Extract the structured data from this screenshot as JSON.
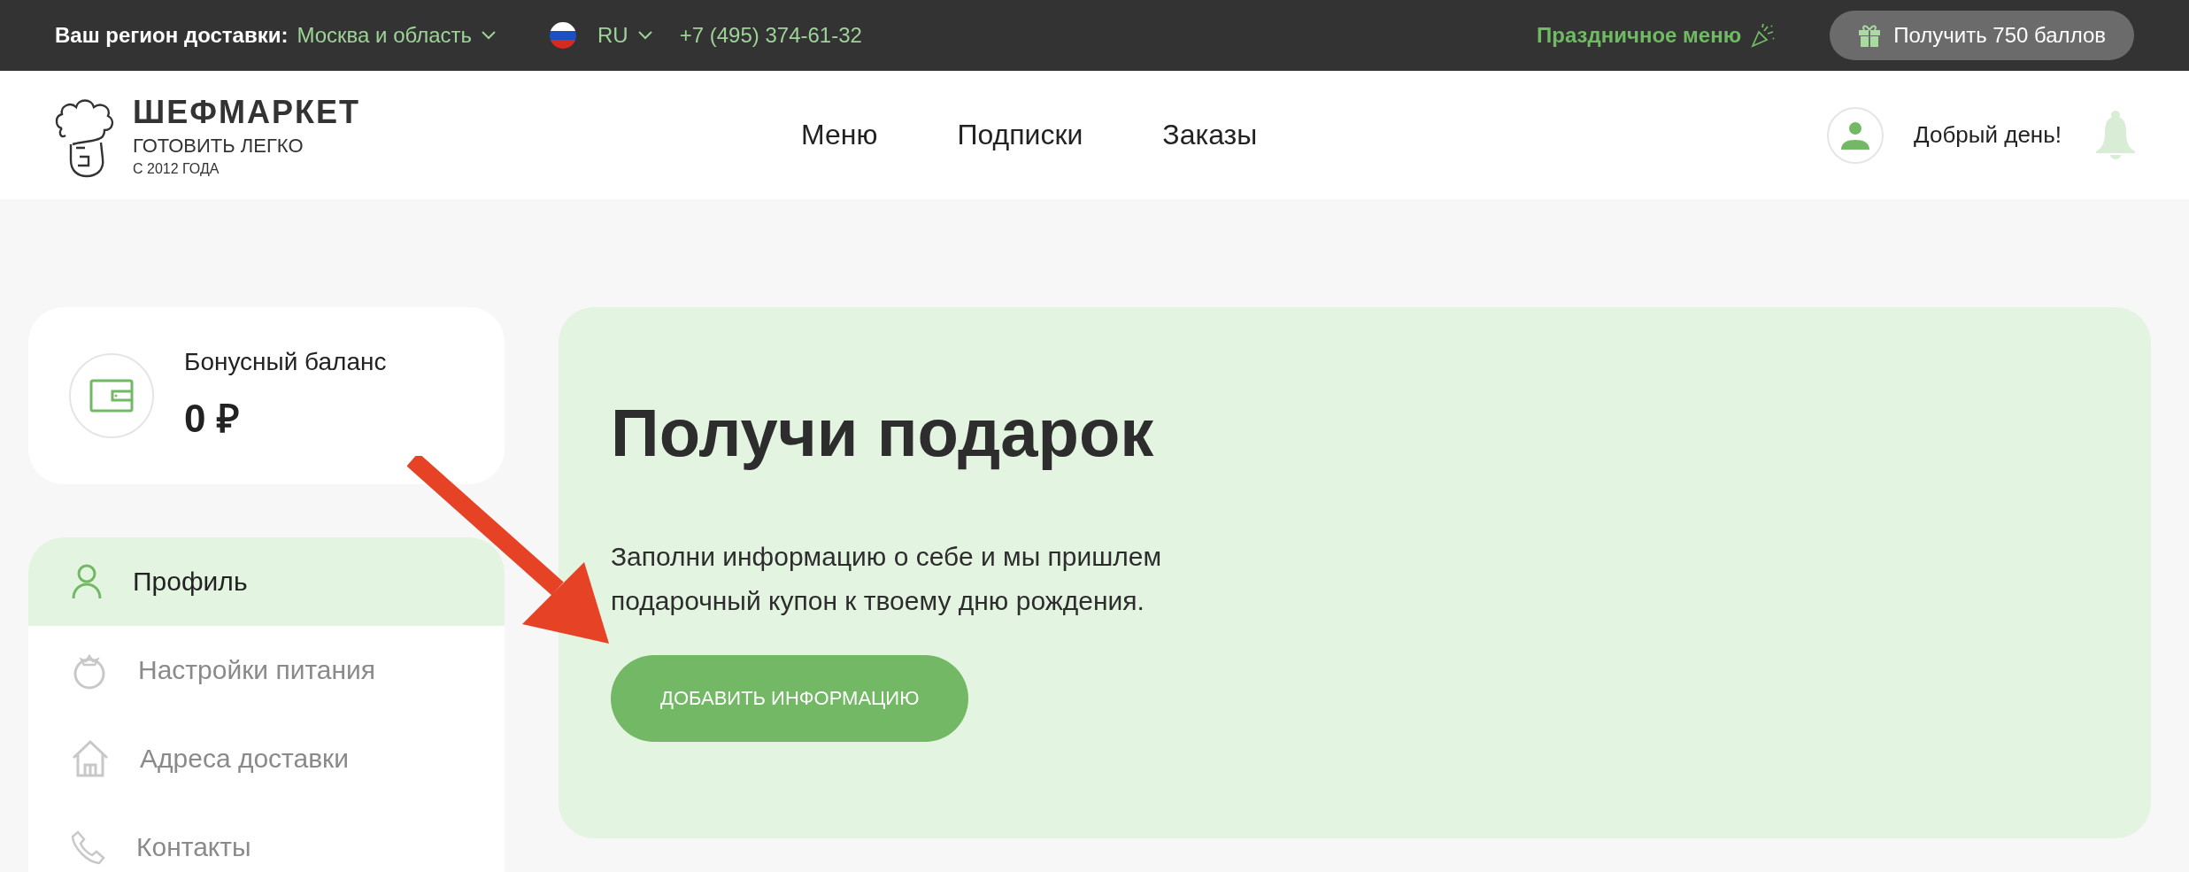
{
  "top_bar": {
    "region_label": "Ваш регион доставки:",
    "region_value": "Москва и область",
    "language": "RU",
    "phone": "+7 (495) 374-61-32",
    "holiday_menu": "Праздничное меню",
    "bonus_button": "Получить 750 баллов"
  },
  "header": {
    "logo": {
      "name": "ШЕФМАРКЕТ",
      "tagline": "ГОТОВИТЬ ЛЕГКО",
      "since": "С 2012 ГОДА"
    },
    "nav": [
      {
        "label": "Меню"
      },
      {
        "label": "Подписки"
      },
      {
        "label": "Заказы"
      }
    ],
    "greeting": "Добрый день!"
  },
  "bonus": {
    "label": "Бонусный баланс",
    "amount": "0 ₽"
  },
  "sidebar": {
    "items": [
      {
        "label": "Профиль",
        "selected": true
      },
      {
        "label": "Настройки питания",
        "selected": false
      },
      {
        "label": "Адреса доставки",
        "selected": false
      },
      {
        "label": "Контакты",
        "selected": false
      }
    ]
  },
  "promo": {
    "title": "Получи подарок",
    "text": "Заполни информацию о себе и мы пришлем подарочный купон к твоему дню рождения.",
    "button": "ДОБАВИТЬ ИНФОРМАЦИЮ"
  }
}
